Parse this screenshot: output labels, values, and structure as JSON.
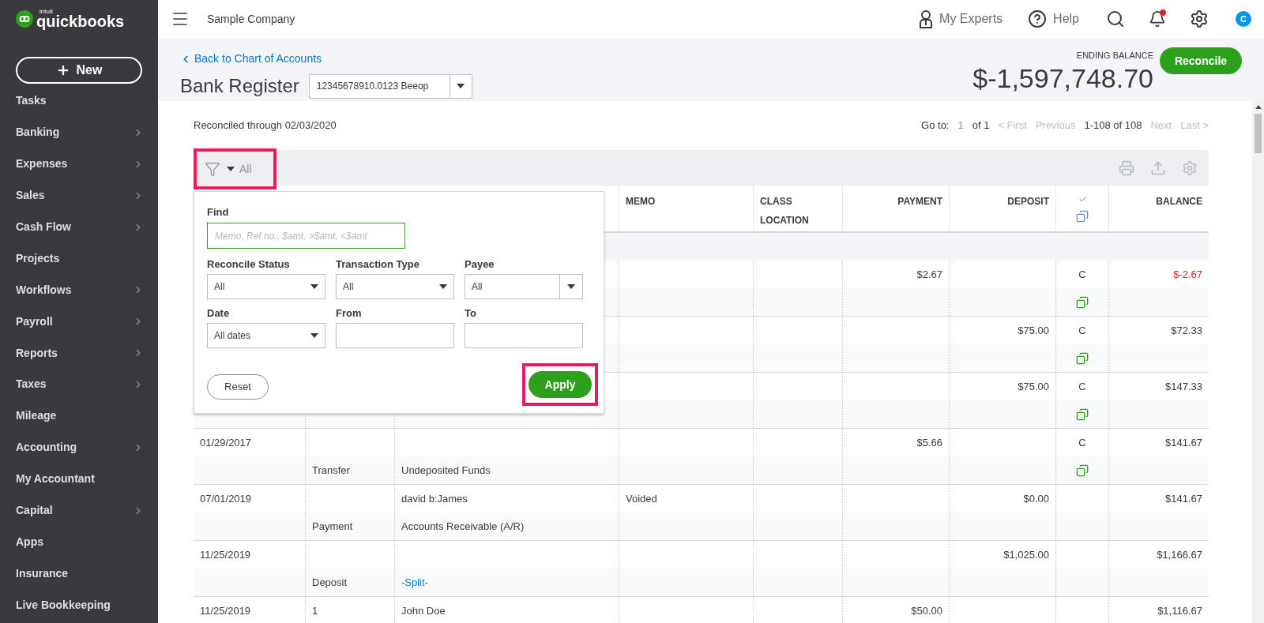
{
  "sidebar": {
    "logo": {
      "brand": "intuit",
      "name": "quickbooks"
    },
    "new_button": "New",
    "items": [
      {
        "label": "Tasks",
        "has_submenu": false
      },
      {
        "label": "Banking",
        "has_submenu": true
      },
      {
        "label": "Expenses",
        "has_submenu": true
      },
      {
        "label": "Sales",
        "has_submenu": true
      },
      {
        "label": "Cash Flow",
        "has_submenu": true
      },
      {
        "label": "Projects",
        "has_submenu": false
      },
      {
        "label": "Workflows",
        "has_submenu": true
      },
      {
        "label": "Payroll",
        "has_submenu": true
      },
      {
        "label": "Reports",
        "has_submenu": true
      },
      {
        "label": "Taxes",
        "has_submenu": true
      },
      {
        "label": "Mileage",
        "has_submenu": false
      },
      {
        "label": "Accounting",
        "has_submenu": true
      },
      {
        "label": "My Accountant",
        "has_submenu": false
      },
      {
        "label": "Capital",
        "has_submenu": true
      },
      {
        "label": "Apps",
        "has_submenu": false
      },
      {
        "label": "Insurance",
        "has_submenu": false
      },
      {
        "label": "Live Bookkeeping",
        "has_submenu": false
      }
    ]
  },
  "header": {
    "company": "Sample Company",
    "my_experts": "My Experts",
    "help": "Help",
    "notification_dot": true,
    "avatar": "C"
  },
  "register": {
    "back_link": "Back to Chart of Accounts",
    "title": "Bank Register",
    "account": "12345678910.0123 Beeop",
    "ending_balance_label": "ENDING BALANCE",
    "ending_balance": "$-1,597,748.70",
    "reconcile_button": "Reconcile"
  },
  "reconciled_through": "Reconciled through 02/03/2020",
  "pagination": {
    "goto_label": "Go to:",
    "page": "1",
    "of": "of 1",
    "prev_links": [
      {
        "label": "< First",
        "disabled": true
      },
      {
        "label": "Previous",
        "disabled": true
      }
    ],
    "range": "1-108 of 108",
    "next_links": [
      {
        "label": "Next",
        "disabled": true
      },
      {
        "label": "Last >",
        "disabled": true
      }
    ]
  },
  "filter": {
    "value": "All"
  },
  "columns": [
    {
      "kind": "text",
      "label": "MEMO"
    },
    {
      "kind": "text",
      "label": "CLASS",
      "sublabel": "LOCATION"
    },
    {
      "kind": "amount",
      "label": "PAYMENT"
    },
    {
      "kind": "amount",
      "label": "DEPOSIT"
    },
    {
      "kind": "icons"
    },
    {
      "kind": "amount",
      "label": "BALANCE"
    }
  ],
  "rows": [
    {
      "payment": "$2.67",
      "status": "C",
      "balance": "$-2.67",
      "negative": true,
      "attachment": true
    },
    {
      "deposit": "$75.00",
      "status": "C",
      "balance": "$72.33",
      "negative": false,
      "attachment": true
    },
    {
      "deposit": "$75.00",
      "status": "C",
      "balance": "$147.33",
      "negative": false,
      "attachment": true
    },
    {
      "date": "01/29/2017",
      "payment": "$5.66",
      "status": "C",
      "balance": "$141.67",
      "negative": false,
      "type": "Transfer",
      "account": "Undeposited Funds",
      "attachment": true,
      "account_link": false
    },
    {
      "date": "07/01/2019",
      "payee": "david b:James",
      "memo": "Voided",
      "deposit": "$0.00",
      "balance": "$141.67",
      "negative": false,
      "type": "Payment",
      "account": "Accounts Receivable (A/R)",
      "attachment": false,
      "account_link": false
    },
    {
      "date": "11/25/2019",
      "deposit": "$1,025.00",
      "balance": "$1,166.67",
      "negative": false,
      "type": "Deposit",
      "account": "-Split-",
      "attachment": false,
      "account_link": true
    },
    {
      "date": "11/25/2019",
      "ref": "1",
      "payee": "John Doe",
      "payment": "$50.00",
      "balance": "$1,116.67",
      "negative": false
    }
  ],
  "filter_panel": {
    "find_label": "Find",
    "find_placeholder": "Memo, Ref no., $amt, >$amt, <$amt",
    "fields": [
      {
        "kind": "select",
        "label": "Reconcile Status",
        "value": "All"
      },
      {
        "kind": "select",
        "label": "Transaction Type",
        "value": "All"
      },
      {
        "kind": "combo",
        "label": "Payee",
        "value": "All"
      },
      {
        "kind": "select",
        "label": "Date",
        "value": "All dates"
      },
      {
        "kind": "input",
        "label": "From"
      },
      {
        "kind": "input",
        "label": "To"
      }
    ],
    "reset_button": "Reset",
    "apply_button": "Apply"
  }
}
